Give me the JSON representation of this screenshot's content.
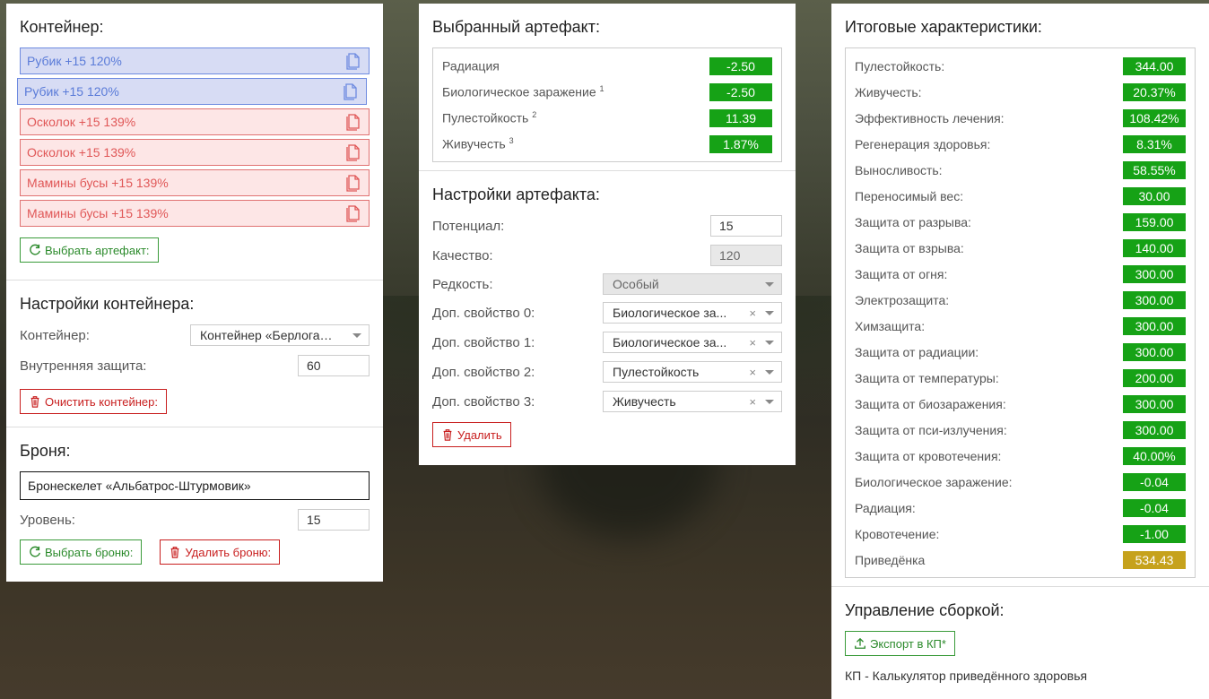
{
  "container": {
    "title": "Контейнер:",
    "items": [
      {
        "label": "Рубик +15 120%",
        "type": "blue"
      },
      {
        "label": "Рубик +15 120%",
        "type": "blue"
      },
      {
        "label": "Осколок +15 139%",
        "type": "red"
      },
      {
        "label": "Осколок +15 139%",
        "type": "red"
      },
      {
        "label": "Мамины бусы +15 139%",
        "type": "red"
      },
      {
        "label": "Мамины бусы +15 139%",
        "type": "red"
      }
    ],
    "select_artifact_label": "Выбрать артефакт:"
  },
  "container_settings": {
    "title": "Настройки контейнера:",
    "container_label": "Контейнер:",
    "container_value": "Контейнер «Берлога…",
    "inner_protection_label": "Внутренняя защита:",
    "inner_protection_value": "60",
    "clear_label": "Очистить контейнер:"
  },
  "armor": {
    "title": "Броня:",
    "value": "Бронескелет «Альбатрос-Штурмовик»",
    "level_label": "Уровень:",
    "level_value": "15",
    "select_label": "Выбрать броню:",
    "delete_label": "Удалить броню:"
  },
  "selected_artifact": {
    "title": "Выбранный артефакт:",
    "stats": [
      {
        "label": "Радиация",
        "sup": "",
        "value": "-2.50"
      },
      {
        "label": "Биологическое заражение",
        "sup": "1",
        "value": "-2.50"
      },
      {
        "label": "Пулестойкость",
        "sup": "2",
        "value": "11.39"
      },
      {
        "label": "Живучесть",
        "sup": "3",
        "value": "1.87%"
      }
    ]
  },
  "artifact_settings": {
    "title": "Настройки артефакта:",
    "potential_label": "Потенциал:",
    "potential_value": "15",
    "quality_label": "Качество:",
    "quality_value": "120",
    "rarity_label": "Редкость:",
    "rarity_value": "Особый",
    "props": [
      {
        "label": "Доп. свойство 0:",
        "value": "Биологическое за..."
      },
      {
        "label": "Доп. свойство 1:",
        "value": "Биологическое за..."
      },
      {
        "label": "Доп. свойство 2:",
        "value": "Пулестойкость"
      },
      {
        "label": "Доп. свойство 3:",
        "value": "Живучесть"
      }
    ],
    "clear_symbol": "×",
    "delete_label": "Удалить"
  },
  "totals": {
    "title": "Итоговые характеристики:",
    "stats": [
      {
        "label": "Пулестойкость:",
        "value": "344.00"
      },
      {
        "label": "Живучесть:",
        "value": "20.37%"
      },
      {
        "label": "Эффективность лечения:",
        "value": "108.42%"
      },
      {
        "label": "Регенерация здоровья:",
        "value": "8.31%"
      },
      {
        "label": "Выносливость:",
        "value": "58.55%"
      },
      {
        "label": "Переносимый вес:",
        "value": "30.00"
      },
      {
        "label": "Защита от разрыва:",
        "value": "159.00"
      },
      {
        "label": "Защита от взрыва:",
        "value": "140.00"
      },
      {
        "label": "Защита от огня:",
        "value": "300.00"
      },
      {
        "label": "Электрозащита:",
        "value": "300.00"
      },
      {
        "label": "Химзащита:",
        "value": "300.00"
      },
      {
        "label": "Защита от радиации:",
        "value": "300.00"
      },
      {
        "label": "Защита от температуры:",
        "value": "200.00"
      },
      {
        "label": "Защита от биозаражения:",
        "value": "300.00"
      },
      {
        "label": "Защита от пси-излучения:",
        "value": "300.00"
      },
      {
        "label": "Защита от кровотечения:",
        "value": "40.00%"
      },
      {
        "label": "Биологическое заражение:",
        "value": "-0.04"
      },
      {
        "label": "Радиация:",
        "value": "-0.04"
      },
      {
        "label": "Кровотечение:",
        "value": "-1.00"
      },
      {
        "label": "Приведёнка",
        "value": "534.43",
        "highlight": "gold"
      }
    ]
  },
  "build": {
    "title": "Управление сборкой:",
    "export_label": "Экспорт в КП*",
    "note": "КП - Калькулятор приведённого здоровья"
  },
  "colors": {
    "stat_green": "#16a216",
    "stat_gold": "#c6a21c",
    "blue_item_bg": "#d7dcf4",
    "red_item_bg": "#fde6e6",
    "accent_green": "#2b8a2b",
    "accent_red": "#c81e1e"
  }
}
